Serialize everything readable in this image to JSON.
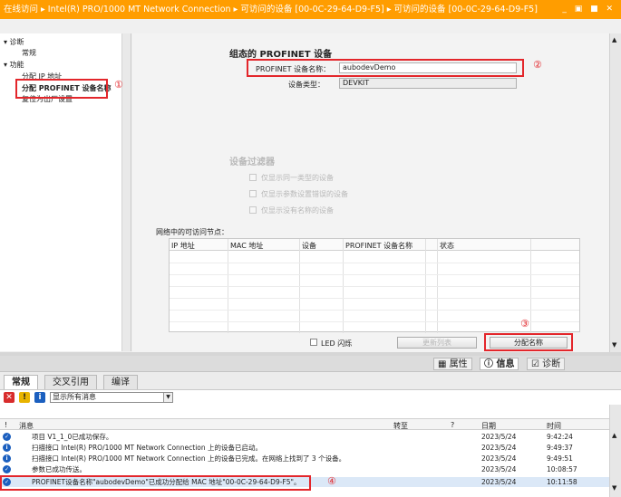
{
  "titlebar": {
    "crumbs": "在线访问 ▸ Intel(R) PRO/1000 MT Network Connection ▸ 可访问的设备 [00-0C-29-64-D9-F5] ▸ 可访问的设备 [00-0C-29-64-D9-F5]",
    "window_buttons": "_ ▣ ■ ✕"
  },
  "tree": {
    "diagnosis": "▾ 诊断",
    "general": "常规",
    "functions": "▾ 功能",
    "assign_ip": "分配 IP 地址",
    "assign_name": "分配 PROFINET 设备名称",
    "reset": "复位为出厂设置"
  },
  "annotations": {
    "n1": "①",
    "n2": "②",
    "n3": "③",
    "n4": "④"
  },
  "config": {
    "title": "组态的 PROFINET 设备",
    "name_label": "PROFINET 设备名称：",
    "name_value": "aubodevDemo",
    "type_label": "设备类型：",
    "type_value": "DEVKIT"
  },
  "filter": {
    "title": "设备过滤器",
    "opt1": "仅显示同一类型的设备",
    "opt2": "仅显示参数设置错误的设备",
    "opt3": "仅显示没有名称的设备"
  },
  "nodes": {
    "title": "网络中的可访问节点：",
    "columns": [
      "IP 地址",
      "MAC 地址",
      "设备",
      "PROFINET 设备名称",
      "状态"
    ]
  },
  "buttons": {
    "led": "LED 闪烁",
    "refresh": "更新列表",
    "assign": "分配名称"
  },
  "inspector": {
    "properties": "属性",
    "info": "信息",
    "diagnostics": "诊断"
  },
  "subtabs": [
    "常规",
    "交叉引用",
    "编译"
  ],
  "message_filter": "显示所有消息",
  "messages": {
    "columns": {
      "icon": "!",
      "message": "消息",
      "goto": "转至",
      "q": "?",
      "date": "日期",
      "time": "时间"
    },
    "rows": [
      {
        "text": "项目 V1_1_0已成功保存。",
        "date": "2023/5/24",
        "time": "9:42:24"
      },
      {
        "text": "扫描接口 Intel(R) PRO/1000 MT Network Connection 上的设备已启动。",
        "date": "2023/5/24",
        "time": "9:49:37"
      },
      {
        "text": "扫描接口 Intel(R) PRO/1000 MT Network Connection 上的设备已完成。在网络上找到了 3 个设备。",
        "date": "2023/5/24",
        "time": "9:49:51"
      },
      {
        "text": "参数已成功传送。",
        "date": "2023/5/24",
        "time": "10:08:57"
      },
      {
        "text": "PROFINET设备名称\"aubodevDemo\"已成功分配给 MAC 地址\"00-0C-29-64-D9-F5\"。",
        "date": "2023/5/24",
        "time": "10:11:58"
      }
    ]
  },
  "colors": {
    "accent": "#ff9d00",
    "highlight": "#e3262b",
    "info": "#1b5fbf"
  }
}
